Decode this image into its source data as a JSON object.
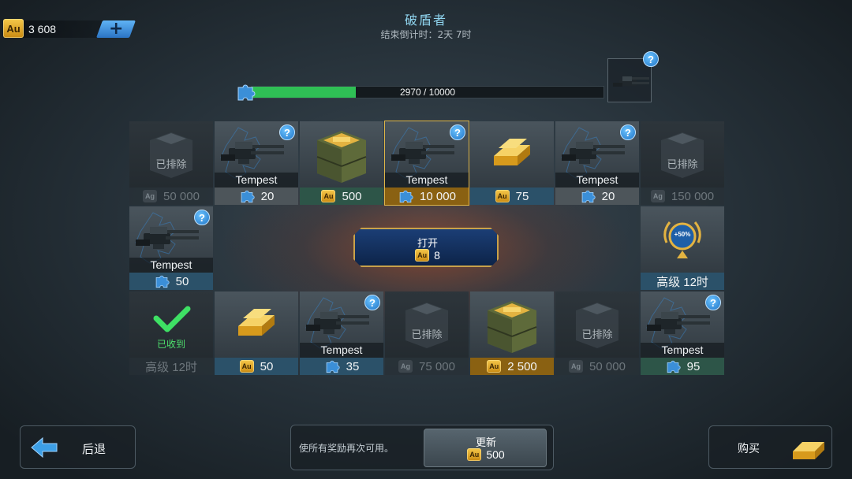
{
  "currency": {
    "gold_symbol": "Au",
    "silver_symbol": "Ag",
    "gold_amount": "3 608",
    "add_label": "+"
  },
  "header": {
    "title": "破盾者",
    "countdown": "结束倒计时：2天 7时"
  },
  "progress": {
    "text": "2970 / 10000",
    "current": 2970,
    "max": 10000,
    "fill_color": "#2fbf55"
  },
  "help_glyph": "?",
  "grid": {
    "cells": [
      {
        "id": "c1",
        "kind": "crate",
        "excluded": true,
        "excluded_label": "已排除",
        "currency": "Ag",
        "amount": "50 000",
        "footer": "faded"
      },
      {
        "id": "c2",
        "kind": "weapon",
        "name": "Tempest",
        "currency": "puzzle",
        "amount": "20",
        "footer": "grey",
        "help": true
      },
      {
        "id": "c3",
        "kind": "gold-crate",
        "currency": "Au",
        "amount": "500",
        "footer": "green"
      },
      {
        "id": "c4",
        "kind": "weapon",
        "name": "Tempest",
        "currency": "puzzle",
        "amount": "10 000",
        "footer": "gold",
        "help": true,
        "selected": true
      },
      {
        "id": "c5",
        "kind": "gold-bars",
        "currency": "Au",
        "amount": "75",
        "footer": "blue"
      },
      {
        "id": "c6",
        "kind": "weapon",
        "name": "Tempest",
        "currency": "puzzle",
        "amount": "20",
        "footer": "grey",
        "help": true
      },
      {
        "id": "c7",
        "kind": "crate",
        "excluded": true,
        "excluded_label": "已排除",
        "currency": "Ag",
        "amount": "150 000",
        "footer": "faded"
      },
      {
        "id": "c8",
        "kind": "weapon",
        "name": "Tempest",
        "currency": "puzzle",
        "amount": "50",
        "footer": "blue",
        "help": true
      },
      {
        "id": "c9",
        "kind": "premium",
        "badge": "+50%",
        "label": "高级 12时",
        "footer": "blue"
      },
      {
        "id": "c10",
        "kind": "collected",
        "collected_label": "已收到",
        "label": "高级 12时",
        "footer": "faded"
      },
      {
        "id": "c11",
        "kind": "gold-bars",
        "currency": "Au",
        "amount": "50",
        "footer": "blue"
      },
      {
        "id": "c12",
        "kind": "weapon",
        "name": "Tempest",
        "currency": "puzzle",
        "amount": "35",
        "footer": "blue",
        "help": true
      },
      {
        "id": "c13",
        "kind": "crate",
        "excluded": true,
        "excluded_label": "已排除",
        "currency": "Ag",
        "amount": "75 000",
        "footer": "faded"
      },
      {
        "id": "c14",
        "kind": "gold-crate",
        "currency": "Au",
        "amount": "2 500",
        "footer": "gold"
      },
      {
        "id": "c15",
        "kind": "crate",
        "excluded": true,
        "excluded_label": "已排除",
        "currency": "Ag",
        "amount": "50 000",
        "footer": "faded"
      },
      {
        "id": "c16",
        "kind": "weapon",
        "name": "Tempest",
        "currency": "puzzle",
        "amount": "95",
        "footer": "green",
        "help": true
      }
    ]
  },
  "open_button": {
    "label": "打开",
    "currency": "Au",
    "cost": "8"
  },
  "bottom": {
    "back_label": "后退",
    "refresh_desc": "使所有奖励再次可用。",
    "refresh_label": "更新",
    "refresh_currency": "Au",
    "refresh_cost": "500",
    "buy_label": "购买"
  }
}
